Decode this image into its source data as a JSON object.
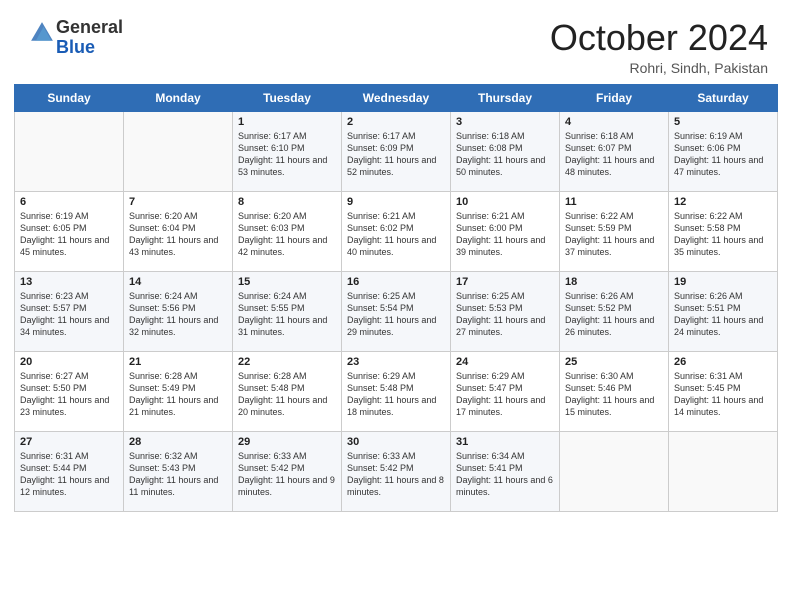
{
  "header": {
    "logo_general": "General",
    "logo_blue": "Blue",
    "month_year": "October 2024",
    "location": "Rohri, Sindh, Pakistan"
  },
  "days_of_week": [
    "Sunday",
    "Monday",
    "Tuesday",
    "Wednesday",
    "Thursday",
    "Friday",
    "Saturday"
  ],
  "weeks": [
    [
      {
        "day": "",
        "sunrise": "",
        "sunset": "",
        "daylight": ""
      },
      {
        "day": "",
        "sunrise": "",
        "sunset": "",
        "daylight": ""
      },
      {
        "day": "1",
        "sunrise": "Sunrise: 6:17 AM",
        "sunset": "Sunset: 6:10 PM",
        "daylight": "Daylight: 11 hours and 53 minutes."
      },
      {
        "day": "2",
        "sunrise": "Sunrise: 6:17 AM",
        "sunset": "Sunset: 6:09 PM",
        "daylight": "Daylight: 11 hours and 52 minutes."
      },
      {
        "day": "3",
        "sunrise": "Sunrise: 6:18 AM",
        "sunset": "Sunset: 6:08 PM",
        "daylight": "Daylight: 11 hours and 50 minutes."
      },
      {
        "day": "4",
        "sunrise": "Sunrise: 6:18 AM",
        "sunset": "Sunset: 6:07 PM",
        "daylight": "Daylight: 11 hours and 48 minutes."
      },
      {
        "day": "5",
        "sunrise": "Sunrise: 6:19 AM",
        "sunset": "Sunset: 6:06 PM",
        "daylight": "Daylight: 11 hours and 47 minutes."
      }
    ],
    [
      {
        "day": "6",
        "sunrise": "Sunrise: 6:19 AM",
        "sunset": "Sunset: 6:05 PM",
        "daylight": "Daylight: 11 hours and 45 minutes."
      },
      {
        "day": "7",
        "sunrise": "Sunrise: 6:20 AM",
        "sunset": "Sunset: 6:04 PM",
        "daylight": "Daylight: 11 hours and 43 minutes."
      },
      {
        "day": "8",
        "sunrise": "Sunrise: 6:20 AM",
        "sunset": "Sunset: 6:03 PM",
        "daylight": "Daylight: 11 hours and 42 minutes."
      },
      {
        "day": "9",
        "sunrise": "Sunrise: 6:21 AM",
        "sunset": "Sunset: 6:02 PM",
        "daylight": "Daylight: 11 hours and 40 minutes."
      },
      {
        "day": "10",
        "sunrise": "Sunrise: 6:21 AM",
        "sunset": "Sunset: 6:00 PM",
        "daylight": "Daylight: 11 hours and 39 minutes."
      },
      {
        "day": "11",
        "sunrise": "Sunrise: 6:22 AM",
        "sunset": "Sunset: 5:59 PM",
        "daylight": "Daylight: 11 hours and 37 minutes."
      },
      {
        "day": "12",
        "sunrise": "Sunrise: 6:22 AM",
        "sunset": "Sunset: 5:58 PM",
        "daylight": "Daylight: 11 hours and 35 minutes."
      }
    ],
    [
      {
        "day": "13",
        "sunrise": "Sunrise: 6:23 AM",
        "sunset": "Sunset: 5:57 PM",
        "daylight": "Daylight: 11 hours and 34 minutes."
      },
      {
        "day": "14",
        "sunrise": "Sunrise: 6:24 AM",
        "sunset": "Sunset: 5:56 PM",
        "daylight": "Daylight: 11 hours and 32 minutes."
      },
      {
        "day": "15",
        "sunrise": "Sunrise: 6:24 AM",
        "sunset": "Sunset: 5:55 PM",
        "daylight": "Daylight: 11 hours and 31 minutes."
      },
      {
        "day": "16",
        "sunrise": "Sunrise: 6:25 AM",
        "sunset": "Sunset: 5:54 PM",
        "daylight": "Daylight: 11 hours and 29 minutes."
      },
      {
        "day": "17",
        "sunrise": "Sunrise: 6:25 AM",
        "sunset": "Sunset: 5:53 PM",
        "daylight": "Daylight: 11 hours and 27 minutes."
      },
      {
        "day": "18",
        "sunrise": "Sunrise: 6:26 AM",
        "sunset": "Sunset: 5:52 PM",
        "daylight": "Daylight: 11 hours and 26 minutes."
      },
      {
        "day": "19",
        "sunrise": "Sunrise: 6:26 AM",
        "sunset": "Sunset: 5:51 PM",
        "daylight": "Daylight: 11 hours and 24 minutes."
      }
    ],
    [
      {
        "day": "20",
        "sunrise": "Sunrise: 6:27 AM",
        "sunset": "Sunset: 5:50 PM",
        "daylight": "Daylight: 11 hours and 23 minutes."
      },
      {
        "day": "21",
        "sunrise": "Sunrise: 6:28 AM",
        "sunset": "Sunset: 5:49 PM",
        "daylight": "Daylight: 11 hours and 21 minutes."
      },
      {
        "day": "22",
        "sunrise": "Sunrise: 6:28 AM",
        "sunset": "Sunset: 5:48 PM",
        "daylight": "Daylight: 11 hours and 20 minutes."
      },
      {
        "day": "23",
        "sunrise": "Sunrise: 6:29 AM",
        "sunset": "Sunset: 5:48 PM",
        "daylight": "Daylight: 11 hours and 18 minutes."
      },
      {
        "day": "24",
        "sunrise": "Sunrise: 6:29 AM",
        "sunset": "Sunset: 5:47 PM",
        "daylight": "Daylight: 11 hours and 17 minutes."
      },
      {
        "day": "25",
        "sunrise": "Sunrise: 6:30 AM",
        "sunset": "Sunset: 5:46 PM",
        "daylight": "Daylight: 11 hours and 15 minutes."
      },
      {
        "day": "26",
        "sunrise": "Sunrise: 6:31 AM",
        "sunset": "Sunset: 5:45 PM",
        "daylight": "Daylight: 11 hours and 14 minutes."
      }
    ],
    [
      {
        "day": "27",
        "sunrise": "Sunrise: 6:31 AM",
        "sunset": "Sunset: 5:44 PM",
        "daylight": "Daylight: 11 hours and 12 minutes."
      },
      {
        "day": "28",
        "sunrise": "Sunrise: 6:32 AM",
        "sunset": "Sunset: 5:43 PM",
        "daylight": "Daylight: 11 hours and 11 minutes."
      },
      {
        "day": "29",
        "sunrise": "Sunrise: 6:33 AM",
        "sunset": "Sunset: 5:42 PM",
        "daylight": "Daylight: 11 hours and 9 minutes."
      },
      {
        "day": "30",
        "sunrise": "Sunrise: 6:33 AM",
        "sunset": "Sunset: 5:42 PM",
        "daylight": "Daylight: 11 hours and 8 minutes."
      },
      {
        "day": "31",
        "sunrise": "Sunrise: 6:34 AM",
        "sunset": "Sunset: 5:41 PM",
        "daylight": "Daylight: 11 hours and 6 minutes."
      },
      {
        "day": "",
        "sunrise": "",
        "sunset": "",
        "daylight": ""
      },
      {
        "day": "",
        "sunrise": "",
        "sunset": "",
        "daylight": ""
      }
    ]
  ]
}
